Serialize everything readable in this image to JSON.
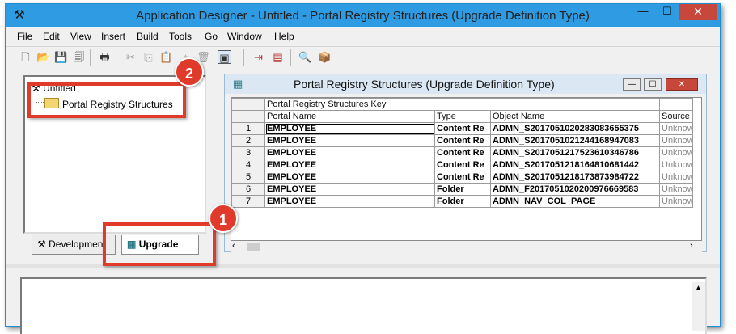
{
  "window": {
    "title": "Application Designer - Untitled - Portal Registry Structures (Upgrade Definition Type)",
    "controls": {
      "minimize": "—",
      "maximize": "☐",
      "close": "✕"
    }
  },
  "menu": [
    "File",
    "Edit",
    "View",
    "Insert",
    "Build",
    "Tools",
    "Go",
    "Window",
    "Help"
  ],
  "toolbar": {
    "icons": [
      "new-icon",
      "open-icon",
      "save-icon",
      "save-all-icon",
      "print-icon",
      "cut-icon",
      "copy-icon",
      "paste-icon",
      "find-icon",
      "delete-icon",
      "properties-icon",
      "insert-into-project-icon",
      "build-icon",
      "find-definitions-icon",
      "validate-icon"
    ],
    "glyphs": [
      "🗋",
      "📂",
      "💾",
      "🗐",
      "🖶",
      "✂",
      "⎘",
      "📋",
      "⌖",
      "🗑",
      "▣",
      "⇥",
      "▤",
      "🔍",
      "📦"
    ]
  },
  "project": {
    "root": "Untitled",
    "child": "Portal Registry Structures"
  },
  "tabs": {
    "development": "Development",
    "upgrade": "Upgrade"
  },
  "child_window": {
    "title": "Portal Registry Structures (Upgrade Definition Type)",
    "group_header": "Portal Registry Structures Key",
    "columns": [
      "Portal Name",
      "Type",
      "Object Name",
      "Source"
    ],
    "rows": [
      {
        "n": "1",
        "portal": "EMPLOYEE",
        "type": "Content Re",
        "object": "ADMN_S20170510202830836553​75",
        "source": "Unknow"
      },
      {
        "n": "2",
        "portal": "EMPLOYEE",
        "type": "Content Re",
        "object": "ADMN_S201705102124416894708​3",
        "source": "Unknow"
      },
      {
        "n": "3",
        "portal": "EMPLOYEE",
        "type": "Content Re",
        "object": "ADMN_S201705121752361034678​6",
        "source": "Unknow"
      },
      {
        "n": "4",
        "portal": "EMPLOYEE",
        "type": "Content Re",
        "object": "ADMN_S201705121816481068144​2",
        "source": "Unknow"
      },
      {
        "n": "5",
        "portal": "EMPLOYEE",
        "type": "Content Re",
        "object": "ADMN_S201705121817387398472​2",
        "source": "Unknow"
      },
      {
        "n": "6",
        "portal": "EMPLOYEE",
        "type": "Folder",
        "object": "ADMN_F201705102020097666958​3",
        "source": "Unknow"
      },
      {
        "n": "7",
        "portal": "EMPLOYEE",
        "type": "Folder",
        "object": "ADMN_NAV_COL_PAGE",
        "source": "Unknow"
      }
    ]
  },
  "callouts": {
    "one": "1",
    "two": "2"
  },
  "colors": {
    "titlebar": "#2f9be3",
    "callout": "#e03a2a",
    "close": "#c7473a"
  }
}
